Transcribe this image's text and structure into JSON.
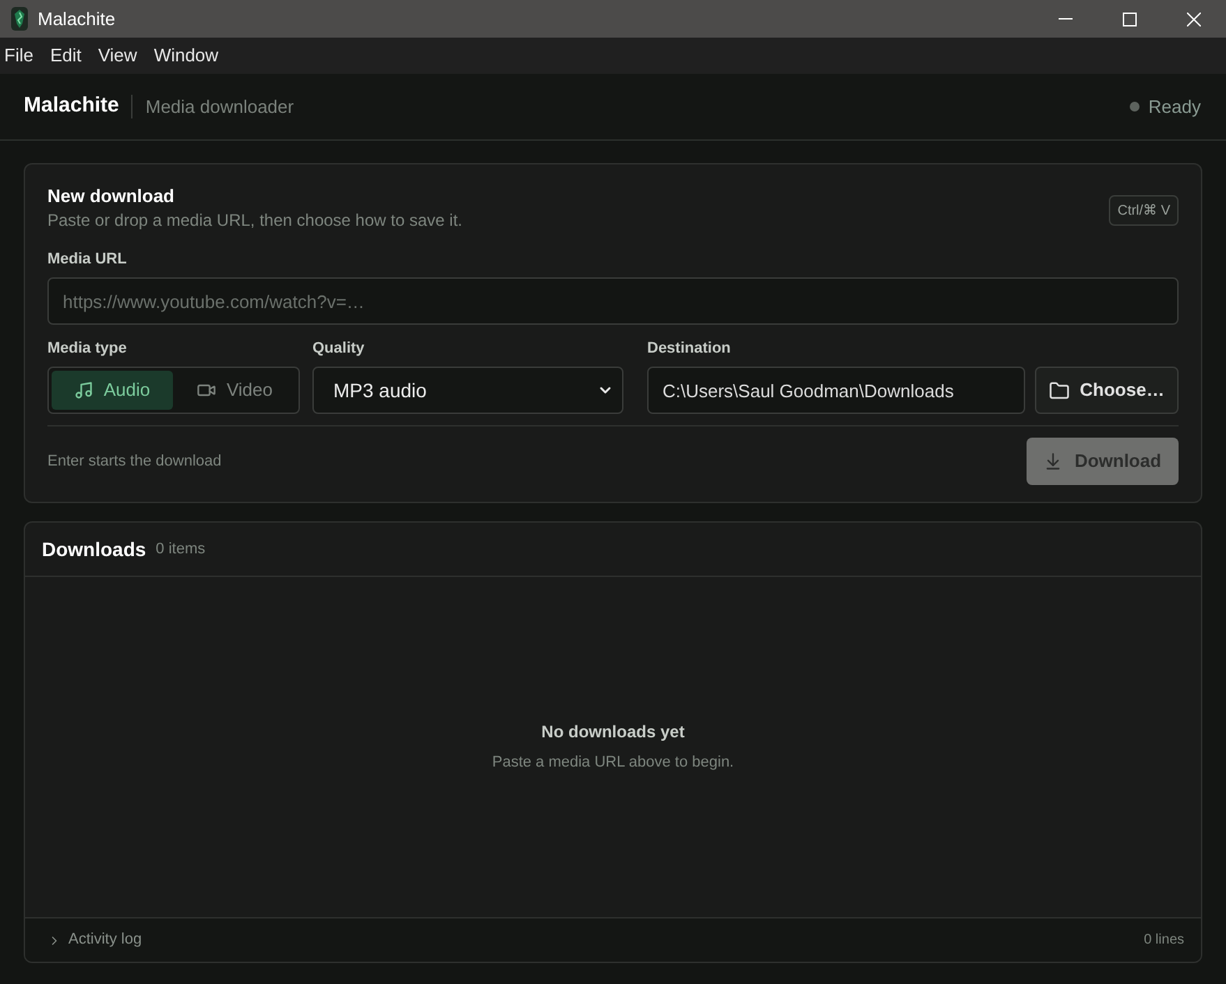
{
  "window": {
    "title": "Malachite"
  },
  "menu": [
    "File",
    "Edit",
    "View",
    "Window"
  ],
  "header": {
    "app_name": "Malachite",
    "subtitle": "Media downloader",
    "status": {
      "label": "Ready",
      "busy": false
    }
  },
  "new_download": {
    "title": "New download",
    "subtitle": "Paste or drop a media URL, then choose how to save it.",
    "shortcut": "Ctrl/⌘ V",
    "url_label": "Media URL",
    "url_placeholder": "https://www.youtube.com/watch?v=…",
    "media_type": {
      "label": "Media type",
      "options": [
        {
          "kind": "audio",
          "label": "Audio",
          "selected": true
        },
        {
          "kind": "video",
          "label": "Video",
          "selected": false
        }
      ]
    },
    "quality": {
      "label": "Quality",
      "value": "MP3 audio"
    },
    "destination": {
      "label": "Destination",
      "value": "C:\\Users\\Saul Goodman\\Downloads"
    },
    "choose_button": "Choose…",
    "hint": "Enter starts the download",
    "download_button": {
      "label": "Download",
      "disabled": true
    }
  },
  "downloads": {
    "title": "Downloads",
    "count": "0 items",
    "empty_title": "No downloads yet",
    "empty_hint": "Paste a media URL above to begin.",
    "activity_log": {
      "label": "Activity log",
      "expanded": false,
      "count": "0 lines"
    }
  }
}
